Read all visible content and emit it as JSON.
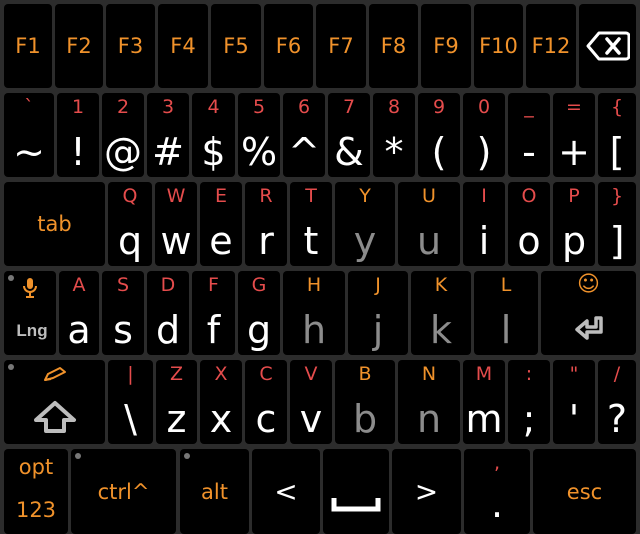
{
  "colors": {
    "background": "#2c2c2c",
    "key": "#000000",
    "main": "#ffffff",
    "secondary_red": "#e54c4c",
    "secondary_orange": "#f0922b",
    "dim": "#8c8c8c"
  },
  "function_row": [
    "F1",
    "F2",
    "F3",
    "F4",
    "F5",
    "F6",
    "F7",
    "F8",
    "F9",
    "F10",
    "F12"
  ],
  "number_row": [
    {
      "top": "`",
      "main": "~"
    },
    {
      "top": "1",
      "main": "!"
    },
    {
      "top": "2",
      "main": "@"
    },
    {
      "top": "3",
      "main": "#"
    },
    {
      "top": "4",
      "main": "$"
    },
    {
      "top": "5",
      "main": "%"
    },
    {
      "top": "6",
      "main": "^"
    },
    {
      "top": "7",
      "main": "&"
    },
    {
      "top": "8",
      "main": "*"
    },
    {
      "top": "9",
      "main": "("
    },
    {
      "top": "0",
      "main": ")"
    },
    {
      "top": "_",
      "main": "-"
    },
    {
      "top": "=",
      "main": "+"
    },
    {
      "top": "{",
      "main": "["
    }
  ],
  "qwerty_row": {
    "tab_label": "tab",
    "keys": [
      {
        "top": "Q",
        "main": "q"
      },
      {
        "top": "W",
        "main": "w"
      },
      {
        "top": "E",
        "main": "e"
      },
      {
        "top": "R",
        "main": "r"
      },
      {
        "top": "T",
        "main": "t"
      },
      {
        "top": "Y",
        "main": "y"
      },
      {
        "top": "U",
        "main": "u"
      },
      {
        "top": "I",
        "main": "i"
      },
      {
        "top": "O",
        "main": "o"
      },
      {
        "top": "P",
        "main": "p"
      },
      {
        "top": "}",
        "main": "]"
      }
    ]
  },
  "asdf_row": {
    "lang_label": "Lng",
    "keys": [
      {
        "top": "A",
        "main": "a"
      },
      {
        "top": "S",
        "main": "s"
      },
      {
        "top": "D",
        "main": "d"
      },
      {
        "top": "F",
        "main": "f"
      },
      {
        "top": "G",
        "main": "g"
      },
      {
        "top": "H",
        "main": "h"
      },
      {
        "top": "J",
        "main": "j"
      },
      {
        "top": "K",
        "main": "k"
      },
      {
        "top": "L",
        "main": "l"
      }
    ],
    "enter_top": "☺"
  },
  "zxcv_row": {
    "keys": [
      {
        "top": "|",
        "main": "\\"
      },
      {
        "top": "Z",
        "main": "z"
      },
      {
        "top": "X",
        "main": "x"
      },
      {
        "top": "C",
        "main": "c"
      },
      {
        "top": "V",
        "main": "v"
      },
      {
        "top": "B",
        "main": "b"
      },
      {
        "top": "N",
        "main": "n"
      },
      {
        "top": "M",
        "main": "m"
      },
      {
        "top": ":",
        "main": ";"
      },
      {
        "top": "\"",
        "main": "'"
      },
      {
        "top": "/",
        "main": "?"
      }
    ]
  },
  "bottom_row": {
    "opt_line1": "opt",
    "opt_line2": "123",
    "ctrl": "ctrl^",
    "alt": "alt",
    "left": "<",
    "right": ">",
    "comma": ",",
    "period": ".",
    "esc": "esc"
  }
}
